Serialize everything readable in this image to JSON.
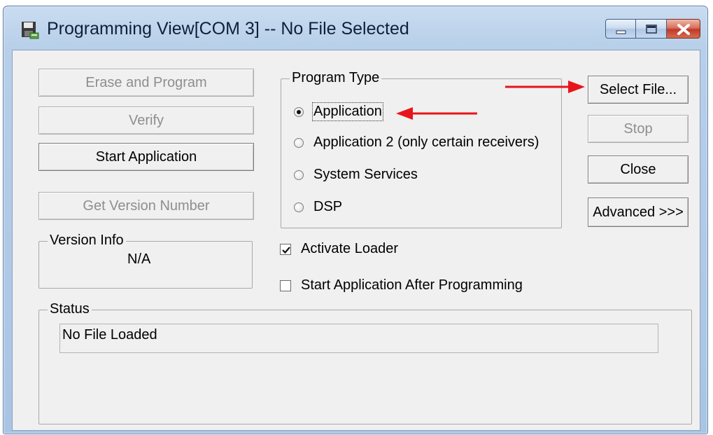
{
  "window": {
    "title": "Programming View[COM 3] -- No File Selected"
  },
  "buttons": {
    "erase_and_program": "Erase and Program",
    "verify": "Verify",
    "start_application": "Start Application",
    "get_version_number": "Get Version Number",
    "select_file": "Select File...",
    "stop": "Stop",
    "close": "Close",
    "advanced": "Advanced >>>"
  },
  "program_type": {
    "label": "Program Type",
    "options": [
      {
        "label": "Application",
        "selected": true
      },
      {
        "label": "Application 2 (only certain receivers)",
        "selected": false
      },
      {
        "label": "System Services",
        "selected": false
      },
      {
        "label": "DSP",
        "selected": false
      }
    ]
  },
  "options": {
    "activate_loader": {
      "label": "Activate Loader",
      "checked": true
    },
    "start_after_programming": {
      "label": "Start Application After Programming",
      "checked": false
    }
  },
  "version_info": {
    "label": "Version Info",
    "value": "N/A"
  },
  "status": {
    "label": "Status",
    "message": "No File Loaded"
  },
  "colors": {
    "annotation_arrow": "#e8141b",
    "disabled_text": "#8e8e8e",
    "dialog_face": "#f0f0f0"
  },
  "icons": {
    "app_icon": "floppy-disk-icon",
    "minimize": "minimize-icon",
    "maximize": "maximize-icon",
    "close": "close-icon"
  }
}
